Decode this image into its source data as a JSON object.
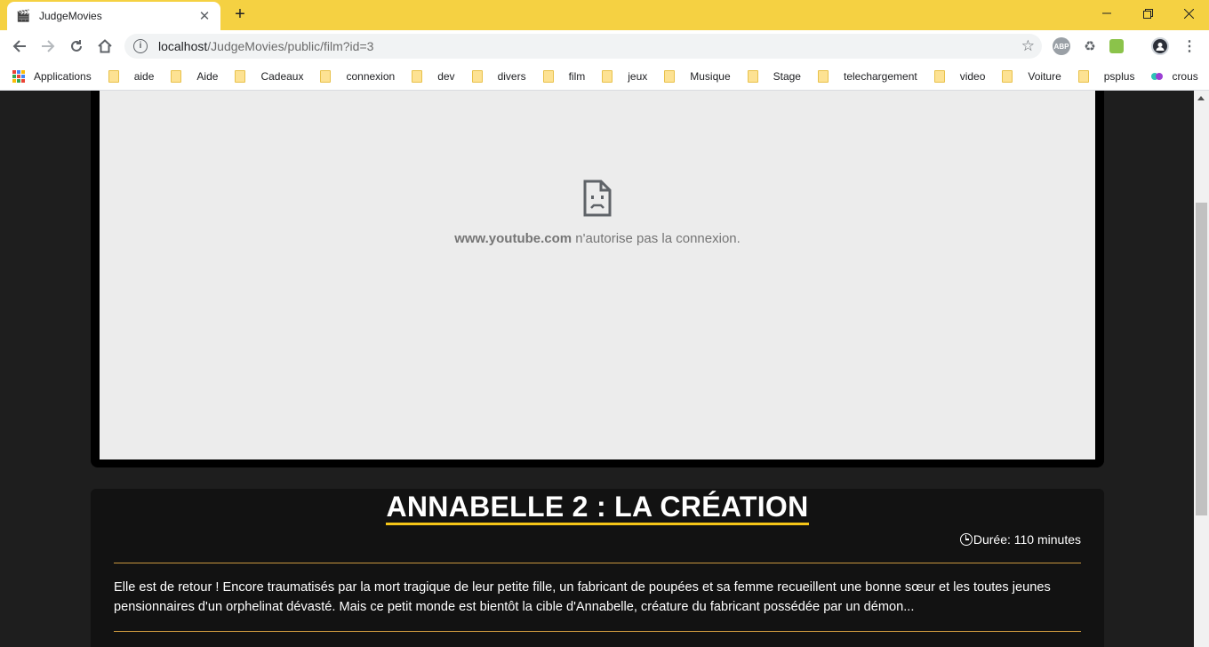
{
  "browser": {
    "tab_title": "JudgeMovies",
    "tab_favicon": "clapperboard-icon",
    "url_host": "localhost",
    "url_path": "/JudgeMovies/public/film?id=3",
    "extensions": [
      "ABP",
      "recycle-icon",
      "shopping-bag-icon",
      "profile-avatar"
    ]
  },
  "bookmarks": [
    {
      "label": "Applications",
      "icon": "apps-grid-icon"
    },
    {
      "label": "aide",
      "icon": "folder-icon"
    },
    {
      "label": "Aide",
      "icon": "folder-icon"
    },
    {
      "label": "Cadeaux",
      "icon": "folder-icon"
    },
    {
      "label": "connexion",
      "icon": "folder-icon"
    },
    {
      "label": "dev",
      "icon": "folder-icon"
    },
    {
      "label": "divers",
      "icon": "folder-icon"
    },
    {
      "label": "film",
      "icon": "folder-icon"
    },
    {
      "label": "jeux",
      "icon": "folder-icon"
    },
    {
      "label": "Musique",
      "icon": "folder-icon"
    },
    {
      "label": "Stage",
      "icon": "folder-icon"
    },
    {
      "label": "telechargement",
      "icon": "folder-icon"
    },
    {
      "label": "video",
      "icon": "folder-icon"
    },
    {
      "label": "Voiture",
      "icon": "folder-icon"
    },
    {
      "label": "psplus",
      "icon": "folder-icon"
    },
    {
      "label": "crous",
      "icon": "crous-icon"
    }
  ],
  "video": {
    "blocked_domain": "www.youtube.com",
    "blocked_text": " n'autorise pas la connexion."
  },
  "film": {
    "title": "ANNABELLE 2 : LA CRÉATION",
    "duration": "Durée: 110 minutes",
    "synopsis": "Elle est de retour ! Encore traumatisés par la mort tragique de leur petite fille, un fabricant de poupées et sa femme recueillent une bonne sœur et les toutes jeunes pensionnaires d'un orphelinat dévasté. Mais ce petit monde est bientôt la cible d'Annabelle, créature du fabricant possédée par un démon..."
  },
  "colors": {
    "titlebar": "#f5d142",
    "accent": "#f5c518",
    "page_bg": "#1e1e1e",
    "card_bg": "#121212",
    "rule": "#c8963e"
  }
}
